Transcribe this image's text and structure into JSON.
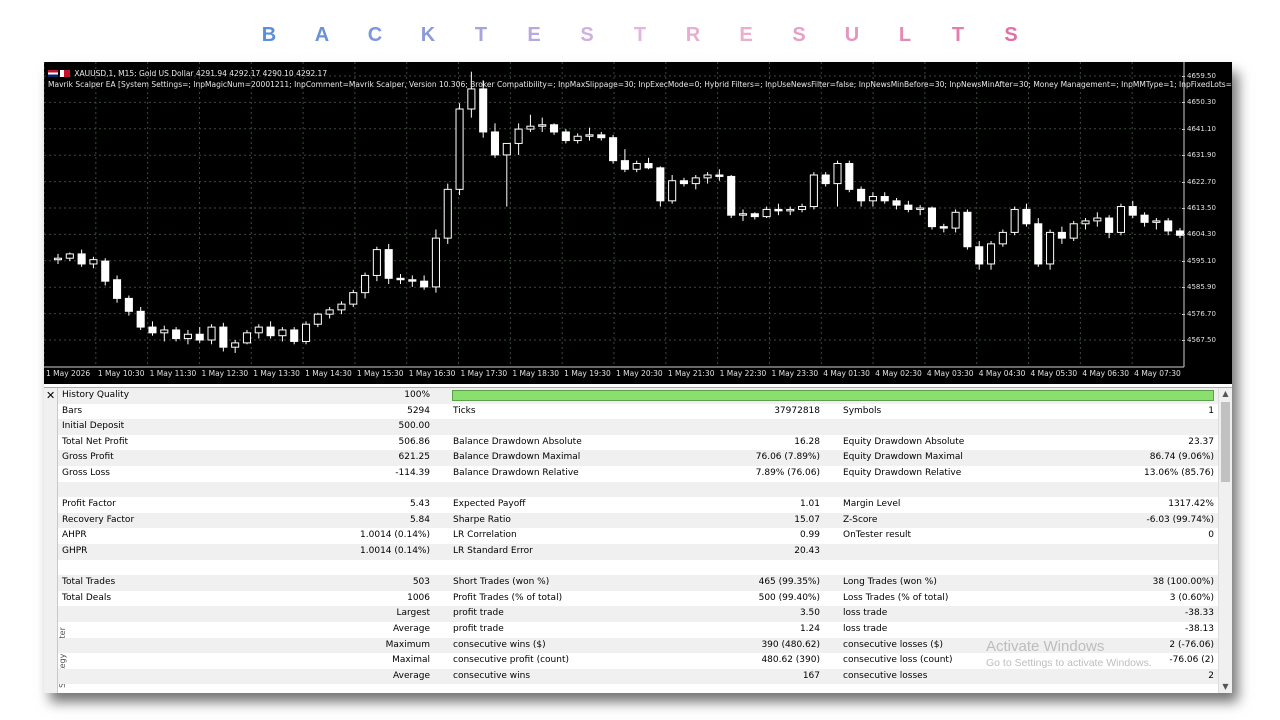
{
  "page_title": {
    "letters": [
      {
        "ch": "B",
        "color": "#5b8fd8"
      },
      {
        "ch": "A",
        "color": "#6a92d6"
      },
      {
        "ch": "C",
        "color": "#7c98d8"
      },
      {
        "ch": "K",
        "color": "#8c9cd8"
      },
      {
        "ch": "T",
        "color": "#a6a4dc"
      },
      {
        "ch": "E",
        "color": "#b8a8e0"
      },
      {
        "ch": "S",
        "color": "#cfb0e2"
      },
      {
        "ch": "T",
        "color": "#e2b6de"
      },
      {
        "ch": "R",
        "color": "#e8aed2"
      },
      {
        "ch": "E",
        "color": "#eeaecb"
      },
      {
        "ch": "S",
        "color": "#e9a0c6"
      },
      {
        "ch": "U",
        "color": "#e596be"
      },
      {
        "ch": "L",
        "color": "#e48ab6"
      },
      {
        "ch": "T",
        "color": "#e37eaf"
      },
      {
        "ch": "S",
        "color": "#e270a6"
      }
    ]
  },
  "chart": {
    "symbol_line": "XAUUSD,1, M15:  Gold US Dollar  4291.94 4292.17 4290.10 4292.17",
    "ea_line": "Mavrik Scalper EA [System Settings=; InpMagicNum=20001211; InpComment=Mavrik Scalper, Version 10.306; Broker Compatibility=; InpMaxSlippage=30; InpExecMode=0; Hybrid Filters=; InpUseNewsFilter=false; InpNewsMinBefore=30; InpNewsMinAfter=30; Money Management=; InpMMType=1; InpFixedLots=0.01; Inp...",
    "price_labels": [
      "4659.50",
      "4650.30",
      "4641.10",
      "4631.90",
      "4622.70",
      "4613.50",
      "4604.30",
      "4595.10",
      "4585.90",
      "4576.70",
      "4567.50"
    ],
    "time_labels": [
      "1 May 2026",
      "1 May 10:30",
      "1 May 11:30",
      "1 May 12:30",
      "1 May 13:30",
      "1 May 14:30",
      "1 May 15:30",
      "1 May 16:30",
      "1 May 17:30",
      "1 May 18:30",
      "1 May 19:30",
      "1 May 20:30",
      "1 May 21:30",
      "1 May 22:30",
      "1 May 23:30",
      "4 May 01:30",
      "4 May 02:30",
      "4 May 03:30",
      "4 May 04:30",
      "4 May 05:30",
      "4 May 06:30",
      "4 May 07:30"
    ],
    "candles": [
      [
        4595.5,
        4597.5,
        4594.0,
        4596.0
      ],
      [
        4596.0,
        4598.0,
        4595.0,
        4597.5
      ],
      [
        4597.5,
        4599.0,
        4593.0,
        4594.0
      ],
      [
        4594.0,
        4596.5,
        4592.5,
        4595.5
      ],
      [
        4595.0,
        4596.0,
        4586.5,
        4588.0
      ],
      [
        4588.5,
        4590.0,
        4580.5,
        4582.0
      ],
      [
        4582.0,
        4583.0,
        4576.0,
        4577.5
      ],
      [
        4577.5,
        4579.0,
        4571.0,
        4572.0
      ],
      [
        4572.0,
        4574.0,
        4569.0,
        4570.0
      ],
      [
        4570.0,
        4572.5,
        4567.0,
        4571.0
      ],
      [
        4571.0,
        4572.0,
        4567.0,
        4568.0
      ],
      [
        4568.0,
        4571.0,
        4566.0,
        4569.5
      ],
      [
        4569.5,
        4572.0,
        4566.5,
        4567.5
      ],
      [
        4567.5,
        4573.0,
        4566.0,
        4572.0
      ],
      [
        4572.0,
        4573.5,
        4563.5,
        4565.0
      ],
      [
        4565.0,
        4567.5,
        4563.0,
        4566.5
      ],
      [
        4566.5,
        4571.0,
        4566.0,
        4570.0
      ],
      [
        4570.0,
        4573.0,
        4568.0,
        4572.0
      ],
      [
        4572.0,
        4574.0,
        4568.0,
        4569.0
      ],
      [
        4569.0,
        4572.0,
        4567.0,
        4571.0
      ],
      [
        4571.0,
        4572.0,
        4566.0,
        4567.0
      ],
      [
        4567.0,
        4574.0,
        4566.0,
        4573.0
      ],
      [
        4573.0,
        4577.0,
        4572.0,
        4576.5
      ],
      [
        4576.5,
        4579.0,
        4575.0,
        4578.0
      ],
      [
        4578.0,
        4581.0,
        4576.5,
        4580.0
      ],
      [
        4580.0,
        4585.0,
        4579.0,
        4584.0
      ],
      [
        4584.0,
        4591.0,
        4582.0,
        4590.0
      ],
      [
        4590.0,
        4600.0,
        4588.0,
        4599.0
      ],
      [
        4599.0,
        4601.0,
        4587.0,
        4589.0
      ],
      [
        4589.0,
        4590.5,
        4587.0,
        4588.5
      ],
      [
        4588.5,
        4590.0,
        4586.0,
        4588.0
      ],
      [
        4588.0,
        4590.0,
        4585.0,
        4586.0
      ],
      [
        4586.0,
        4606.0,
        4584.0,
        4603.0
      ],
      [
        4603.0,
        4622.0,
        4601.0,
        4620.0
      ],
      [
        4620.0,
        4650.0,
        4618.0,
        4648.0
      ],
      [
        4648.0,
        4661.0,
        4645.0,
        4655.0
      ],
      [
        4655.0,
        4658.0,
        4638.0,
        4640.0
      ],
      [
        4640.0,
        4643.0,
        4631.0,
        4632.0
      ],
      [
        4632.0,
        4635.0,
        4614.0,
        4636.0
      ],
      [
        4636.0,
        4643.0,
        4632.0,
        4641.0
      ],
      [
        4641.0,
        4646.0,
        4640.0,
        4642.0
      ],
      [
        4642.0,
        4645.0,
        4640.0,
        4642.5
      ],
      [
        4642.5,
        4643.0,
        4639.0,
        4640.0
      ],
      [
        4640.0,
        4641.0,
        4636.0,
        4637.0
      ],
      [
        4637.0,
        4639.5,
        4636.0,
        4638.5
      ],
      [
        4638.5,
        4641.5,
        4637.0,
        4639.0
      ],
      [
        4639.0,
        4640.0,
        4637.0,
        4638.0
      ],
      [
        4638.0,
        4639.0,
        4629.0,
        4630.0
      ],
      [
        4630.0,
        4634.0,
        4626.0,
        4627.0
      ],
      [
        4627.0,
        4630.0,
        4626.0,
        4629.0
      ],
      [
        4629.0,
        4631.0,
        4627.0,
        4627.5
      ],
      [
        4627.5,
        4628.0,
        4614.0,
        4616.0
      ],
      [
        4616.0,
        4625.0,
        4615.0,
        4623.0
      ],
      [
        4623.0,
        4624.0,
        4621.0,
        4622.0
      ],
      [
        4622.0,
        4625.0,
        4620.0,
        4624.0
      ],
      [
        4624.0,
        4626.0,
        4622.0,
        4625.0
      ],
      [
        4625.0,
        4627.0,
        4623.0,
        4624.5
      ],
      [
        4624.5,
        4625.0,
        4610.0,
        4611.0
      ],
      [
        4611.0,
        4613.0,
        4609.0,
        4611.5
      ],
      [
        4611.5,
        4612.0,
        4609.5,
        4610.5
      ],
      [
        4610.5,
        4614.0,
        4610.0,
        4613.0
      ],
      [
        4613.0,
        4615.0,
        4611.0,
        4612.5
      ],
      [
        4612.5,
        4614.0,
        4611.0,
        4613.0
      ],
      [
        4613.0,
        4615.0,
        4612.0,
        4614.0
      ],
      [
        4614.0,
        4626.0,
        4613.0,
        4625.0
      ],
      [
        4625.0,
        4626.0,
        4621.0,
        4622.0
      ],
      [
        4622.0,
        4630.0,
        4614.0,
        4629.0
      ],
      [
        4629.0,
        4630.0,
        4619.0,
        4620.0
      ],
      [
        4620.0,
        4621.0,
        4614.0,
        4616.0
      ],
      [
        4616.0,
        4619.0,
        4614.0,
        4617.5
      ],
      [
        4617.5,
        4619.0,
        4615.0,
        4616.0
      ],
      [
        4616.0,
        4617.0,
        4613.0,
        4614.5
      ],
      [
        4614.5,
        4616.0,
        4612.0,
        4613.0
      ],
      [
        4613.0,
        4614.5,
        4611.0,
        4613.5
      ],
      [
        4613.5,
        4614.0,
        4606.0,
        4607.0
      ],
      [
        4607.0,
        4608.0,
        4605.0,
        4606.5
      ],
      [
        4606.5,
        4613.0,
        4605.0,
        4612.0
      ],
      [
        4612.0,
        4613.0,
        4599.0,
        4600.0
      ],
      [
        4600.0,
        4602.0,
        4592.0,
        4594.0
      ],
      [
        4594.0,
        4602.0,
        4592.0,
        4601.0
      ],
      [
        4601.0,
        4606.0,
        4600.0,
        4605.0
      ],
      [
        4605.0,
        4614.0,
        4604.0,
        4613.0
      ],
      [
        4613.0,
        4615.0,
        4607.0,
        4608.0
      ],
      [
        4608.0,
        4610.0,
        4593.0,
        4594.0
      ],
      [
        4594.0,
        4606.0,
        4592.0,
        4605.0
      ],
      [
        4605.0,
        4607.0,
        4601.0,
        4603.0
      ],
      [
        4603.0,
        4609.0,
        4602.0,
        4608.0
      ],
      [
        4608.0,
        4610.0,
        4606.0,
        4609.0
      ],
      [
        4609.0,
        4612.0,
        4607.0,
        4610.0
      ],
      [
        4610.0,
        4611.0,
        4603.0,
        4605.0
      ],
      [
        4605.0,
        4615.0,
        4604.0,
        4614.0
      ],
      [
        4614.0,
        4616.0,
        4610.0,
        4611.0
      ],
      [
        4611.0,
        4612.0,
        4607.0,
        4608.5
      ],
      [
        4608.5,
        4610.0,
        4606.0,
        4609.0
      ],
      [
        4609.0,
        4610.0,
        4604.0,
        4605.5
      ],
      [
        4605.5,
        4606.5,
        4603.0,
        4604.0
      ]
    ],
    "colors": {
      "background": "#000000",
      "grid": "#3c4a3c",
      "candle": "#ffffff",
      "wick": "#ffffff"
    }
  },
  "tester": {
    "side_label": "Strategy Tester",
    "rows": [
      {
        "l1": "History Quality",
        "v1": "100%",
        "bar": true
      },
      {
        "l1": "Bars",
        "v1": "5294",
        "l2": "Ticks",
        "v2": "37972818",
        "l3": "Symbols",
        "v3": "1"
      },
      {
        "l1": "Initial Deposit",
        "v1": "500.00"
      },
      {
        "l1": "Total Net Profit",
        "v1": "506.86",
        "l2": "Balance Drawdown Absolute",
        "v2": "16.28",
        "l3": "Equity Drawdown Absolute",
        "v3": "23.37"
      },
      {
        "l1": "Gross Profit",
        "v1": "621.25",
        "l2": "Balance Drawdown Maximal",
        "v2": "76.06 (7.89%)",
        "l3": "Equity Drawdown Maximal",
        "v3": "86.74 (9.06%)"
      },
      {
        "l1": "Gross Loss",
        "v1": "-114.39",
        "l2": "Balance Drawdown Relative",
        "v2": "7.89% (76.06)",
        "l3": "Equity Drawdown Relative",
        "v3": "13.06% (85.76)"
      },
      {},
      {
        "l1": "Profit Factor",
        "v1": "5.43",
        "l2": "Expected Payoff",
        "v2": "1.01",
        "l3": "Margin Level",
        "v3": "1317.42%"
      },
      {
        "l1": "Recovery Factor",
        "v1": "5.84",
        "l2": "Sharpe Ratio",
        "v2": "15.07",
        "l3": "Z-Score",
        "v3": "-6.03 (99.74%)"
      },
      {
        "l1": "AHPR",
        "v1": "1.0014 (0.14%)",
        "l2": "LR Correlation",
        "v2": "0.99",
        "l3": "OnTester result",
        "v3": "0"
      },
      {
        "l1": "GHPR",
        "v1": "1.0014 (0.14%)",
        "l2": "LR Standard Error",
        "v2": "20.43"
      },
      {},
      {
        "l1": "Total Trades",
        "v1": "503",
        "l2": "Short Trades (won %)",
        "v2": "465 (99.35%)",
        "l3": "Long Trades (won %)",
        "v3": "38 (100.00%)"
      },
      {
        "l1": "Total Deals",
        "v1": "1006",
        "l2": "Profit Trades (% of total)",
        "v2": "500 (99.40%)",
        "l3": "Loss Trades (% of total)",
        "v3": "3 (0.60%)"
      },
      {
        "v1": "Largest",
        "l2": "profit trade",
        "v2": "3.50",
        "l3": "loss trade",
        "v3": "-38.33"
      },
      {
        "v1": "Average",
        "l2": "profit trade",
        "v2": "1.24",
        "l3": "loss trade",
        "v3": "-38.13"
      },
      {
        "v1": "Maximum",
        "l2": "consecutive wins ($)",
        "v2": "390 (480.62)",
        "l3": "consecutive losses ($)",
        "v3": "2 (-76.06)"
      },
      {
        "v1": "Maximal",
        "l2": "consecutive profit (count)",
        "v2": "480.62 (390)",
        "l3": "consecutive loss (count)",
        "v3": "-76.06 (2)"
      },
      {
        "v1": "Average",
        "l2": "consecutive wins",
        "v2": "167",
        "l3": "consecutive losses",
        "v3": "2"
      }
    ],
    "history_quality_fill": 1.0
  },
  "watermark": {
    "title": "Activate Windows",
    "subtitle": "Go to Settings to activate Windows."
  }
}
